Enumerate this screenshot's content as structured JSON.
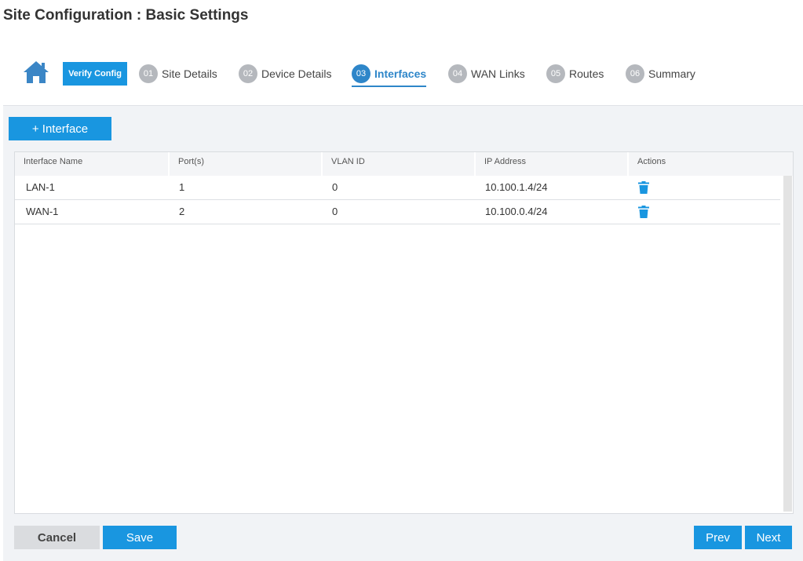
{
  "page": {
    "title": "Site Configuration : Basic Settings"
  },
  "wizard": {
    "home_icon": "home-icon",
    "verify_label": "Verify Config",
    "steps": [
      {
        "num": "01",
        "label": "Site Details",
        "active": false
      },
      {
        "num": "02",
        "label": "Device Details",
        "active": false
      },
      {
        "num": "03",
        "label": "Interfaces",
        "active": true
      },
      {
        "num": "04",
        "label": "WAN Links",
        "active": false
      },
      {
        "num": "05",
        "label": "Routes",
        "active": false
      },
      {
        "num": "06",
        "label": "Summary",
        "active": false
      }
    ]
  },
  "toolbar": {
    "add_label": "+ Interface"
  },
  "table": {
    "columns": [
      "Interface Name",
      "Port(s)",
      "VLAN ID",
      "IP Address",
      "Actions"
    ],
    "rows": [
      {
        "name": "LAN-1",
        "ports": "1",
        "vlan": "0",
        "ip": "10.100.1.4/24",
        "action_icon": "trash-icon"
      },
      {
        "name": "WAN-1",
        "ports": "2",
        "vlan": "0",
        "ip": "10.100.0.4/24",
        "action_icon": "trash-icon"
      }
    ]
  },
  "footer": {
    "cancel_label": "Cancel",
    "save_label": "Save",
    "prev_label": "Prev",
    "next_label": "Next"
  },
  "colors": {
    "accent": "#1996e0",
    "active_step": "#2e86c9",
    "inactive_step": "#b5b8bd"
  }
}
